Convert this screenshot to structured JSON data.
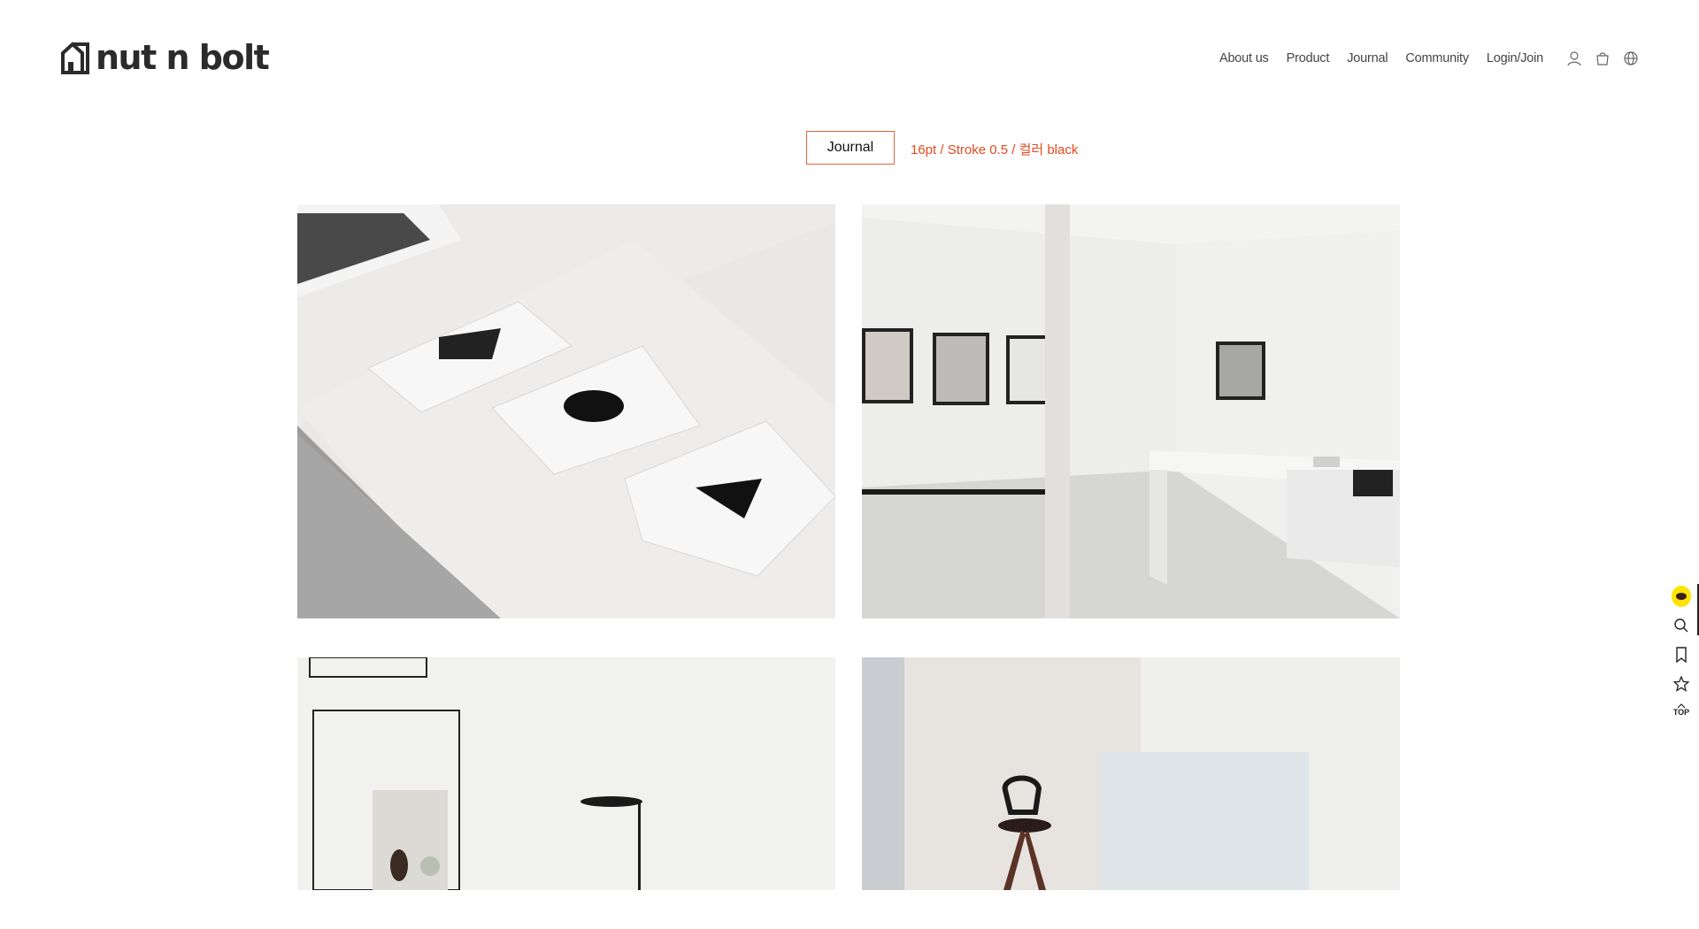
{
  "brand": {
    "name": "nut n bolt"
  },
  "nav": {
    "items": [
      "About us",
      "Product",
      "Journal",
      "Community",
      "Login/Join"
    ],
    "icons": [
      "user-icon",
      "shopping-bag-icon",
      "globe-icon"
    ]
  },
  "section": {
    "title": "Journal",
    "annotation": "16pt / Stroke 0.5 / 컬러 black",
    "annotation_color": "#e24a1f"
  },
  "quickbar": {
    "icons": [
      "kakao-talk-icon",
      "search-icon",
      "bookmark-icon",
      "star-icon",
      "top-arrow-icon"
    ],
    "top_label": "TOP"
  }
}
